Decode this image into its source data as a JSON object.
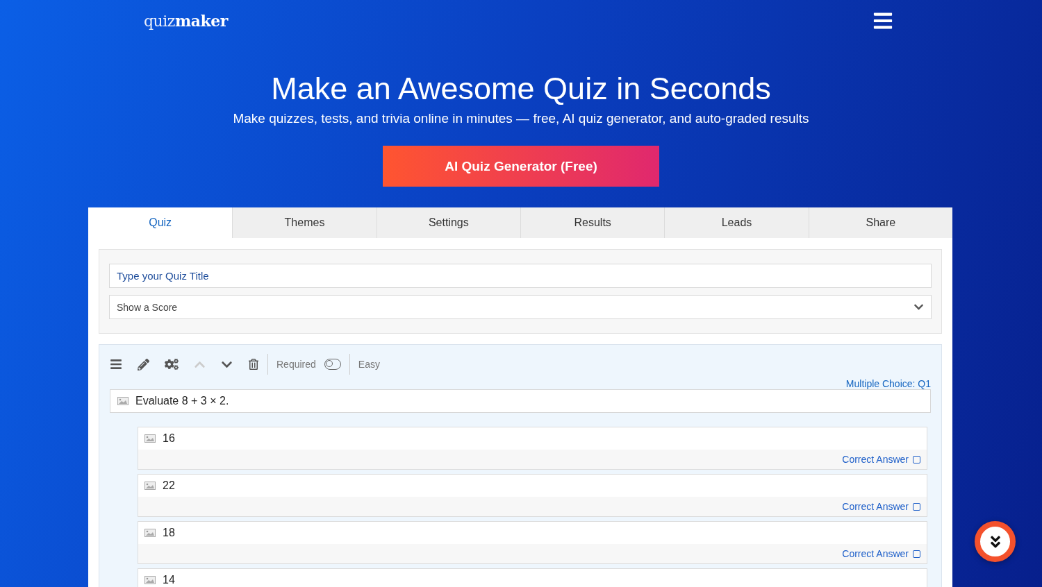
{
  "header": {
    "logo": "quiz**maker**"
  },
  "hero": {
    "title": "Make an Awesome Quiz in Seconds",
    "subtitle": "Make quizzes, tests, and trivia online in minutes — free, AI quiz generator, and auto-graded results",
    "cta": "AI Quiz Generator (Free)"
  },
  "tabs": [
    {
      "label": "Quiz",
      "selected": true
    },
    {
      "label": "Themes",
      "selected": false
    },
    {
      "label": "Settings",
      "selected": false
    },
    {
      "label": "Results",
      "selected": false
    },
    {
      "label": "Leads",
      "selected": false
    },
    {
      "label": "Share",
      "selected": false
    }
  ],
  "quiz": {
    "title_placeholder": "Type your Quiz Title",
    "score_select": "Show a Score"
  },
  "question": {
    "required_label": "Required",
    "required": false,
    "difficulty": "Easy",
    "type_label": "Multiple Choice: Q1",
    "text": "Evaluate 8 + 3 × 2.",
    "answers": [
      {
        "text": "16",
        "correct_label": "Correct Answer",
        "checked": false
      },
      {
        "text": "22",
        "correct_label": "Correct Answer",
        "checked": false
      },
      {
        "text": "18",
        "correct_label": "Correct Answer",
        "checked": false
      },
      {
        "text": "14"
      }
    ]
  }
}
